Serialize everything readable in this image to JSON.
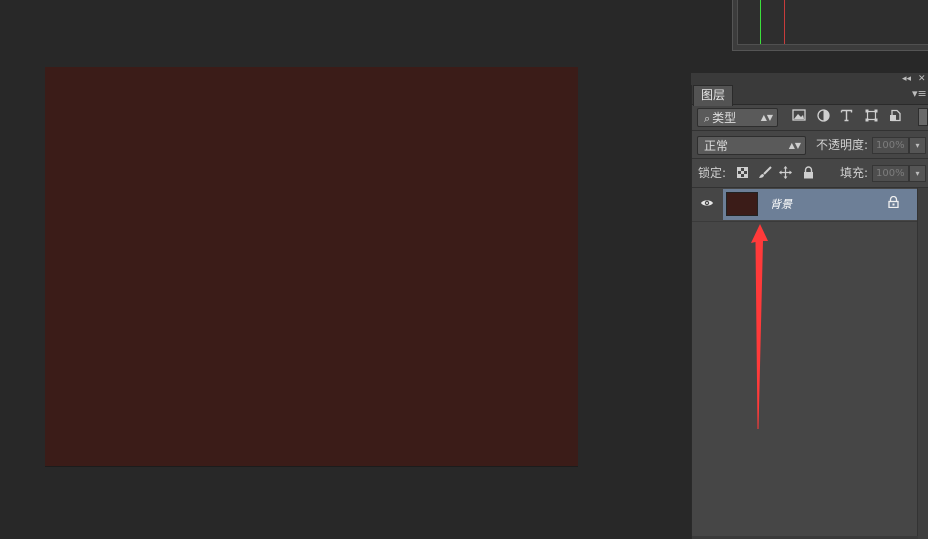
{
  "colors": {
    "canvas_fill": "#3b1c18",
    "thumb_fill": "#3b1c18",
    "selected_row": "#6d7f97",
    "annotation_arrow": "#ff3a3a"
  },
  "layers_panel": {
    "collapse_icon": "◂◂",
    "close_icon": "✕",
    "tab_label": "图层",
    "menu_icon": "▾≡",
    "filter": {
      "search_icon": "⌕",
      "value": "类型",
      "arrow": "▲▼",
      "icons": [
        "image-filter-icon",
        "adjustment-filter-icon",
        "type-filter-icon",
        "shape-filter-icon",
        "smart-object-filter-icon"
      ]
    },
    "blend": {
      "value": "正常",
      "arrow": "▲▼",
      "opacity_label": "不透明度:",
      "opacity_value": "100%",
      "dropdown": "▾"
    },
    "lock": {
      "label": "锁定:",
      "fill_label": "填充:",
      "fill_value": "100%",
      "dropdown": "▾"
    },
    "layers": [
      {
        "name": "背景",
        "visible": true,
        "locked": true,
        "selected": true
      }
    ]
  }
}
